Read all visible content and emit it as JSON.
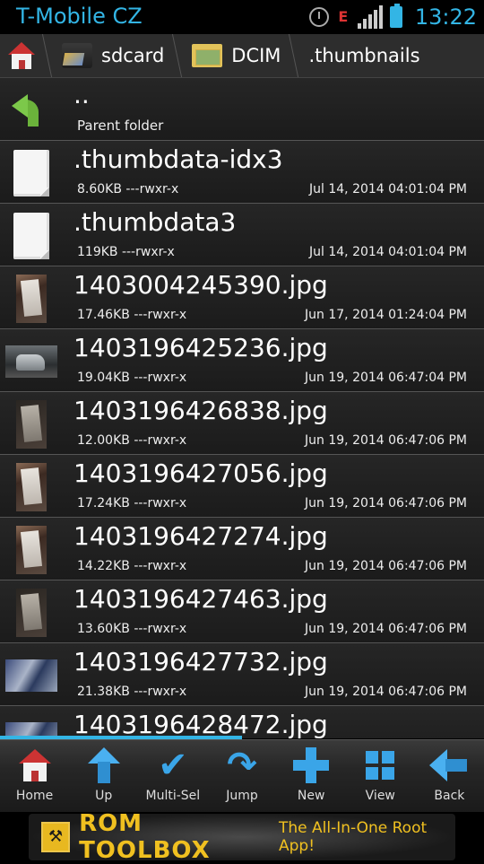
{
  "status_bar": {
    "carrier": "T-Mobile CZ",
    "time": "13:22",
    "icons": [
      "alarm-icon",
      "sync-error-icon",
      "signal-icon",
      "battery-icon"
    ],
    "accent_color": "#33b5e5"
  },
  "breadcrumb": {
    "home_icon": "home-icon",
    "crumbs": [
      {
        "label": "sdcard",
        "icon": "sdcard-icon"
      },
      {
        "label": "DCIM",
        "icon": "folder-image-icon"
      },
      {
        "label": ".thumbnails",
        "icon": ""
      }
    ]
  },
  "list": {
    "parent": {
      "name": "..",
      "subtitle": "Parent folder",
      "icon": "back-arrow-icon"
    },
    "files": [
      {
        "name": ".thumbdata-idx3",
        "info": "8.60KB ---rwxr-x",
        "date": "Jul 14, 2014 04:01:04 PM",
        "thumb": "document-icon"
      },
      {
        "name": ".thumbdata3",
        "info": "119KB ---rwxr-x",
        "date": "Jul 14, 2014 04:01:04 PM",
        "thumb": "document-icon"
      },
      {
        "name": "1403004245390.jpg",
        "info": "17.46KB ---rwxr-x",
        "date": "Jun 17, 2014 01:24:04 PM",
        "thumb": "receipt-photo"
      },
      {
        "name": "1403196425236.jpg",
        "info": "19.04KB ---rwxr-x",
        "date": "Jun 19, 2014 06:47:04 PM",
        "thumb": "car-photo"
      },
      {
        "name": "1403196426838.jpg",
        "info": "12.00KB ---rwxr-x",
        "date": "Jun 19, 2014 06:47:06 PM",
        "thumb": "receipt-photo-dark"
      },
      {
        "name": "1403196427056.jpg",
        "info": "17.24KB ---rwxr-x",
        "date": "Jun 19, 2014 06:47:06 PM",
        "thumb": "receipt-photo"
      },
      {
        "name": "1403196427274.jpg",
        "info": "14.22KB ---rwxr-x",
        "date": "Jun 19, 2014 06:47:06 PM",
        "thumb": "receipt-photo"
      },
      {
        "name": "1403196427463.jpg",
        "info": "13.60KB ---rwxr-x",
        "date": "Jun 19, 2014 06:47:06 PM",
        "thumb": "receipt-photo-dark"
      },
      {
        "name": "1403196427732.jpg",
        "info": "21.38KB ---rwxr-x",
        "date": "Jun 19, 2014 06:47:06 PM",
        "thumb": "desk-photo"
      },
      {
        "name": "1403196428472.jpg",
        "info": "",
        "date": "",
        "thumb": "desk-photo"
      }
    ]
  },
  "toolbar": {
    "items": [
      {
        "label": "Home",
        "icon": "home-icon"
      },
      {
        "label": "Up",
        "icon": "up-arrow-icon"
      },
      {
        "label": "Multi-Sel",
        "icon": "checkmark-icon"
      },
      {
        "label": "Jump",
        "icon": "jump-arrow-icon"
      },
      {
        "label": "New",
        "icon": "plus-icon"
      },
      {
        "label": "View",
        "icon": "grid-view-icon"
      },
      {
        "label": "Back",
        "icon": "back-arrow-icon"
      }
    ]
  },
  "ad": {
    "title": "ROM TOOLBOX",
    "tagline": "The All-In-One Root App!",
    "color": "#f0c020"
  }
}
